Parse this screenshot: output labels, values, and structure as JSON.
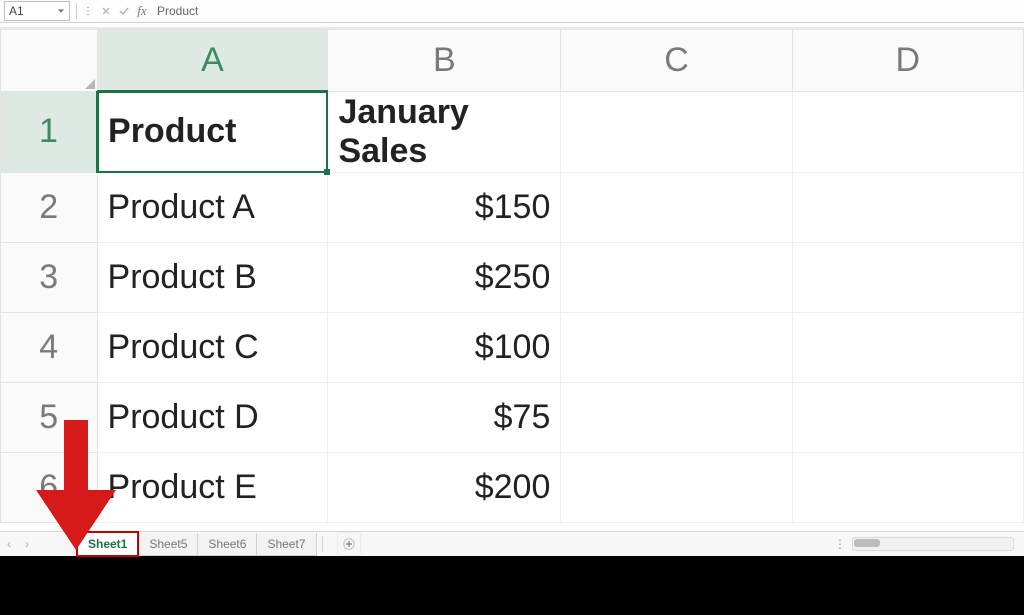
{
  "namebox": "A1",
  "formula_value": "Product",
  "columns": [
    "A",
    "B",
    "C",
    "D"
  ],
  "rows": [
    {
      "n": "1",
      "A": "Product",
      "B": "January Sales",
      "boldA": true,
      "boldB": true,
      "selected": true
    },
    {
      "n": "2",
      "A": "Product A",
      "B": "$150"
    },
    {
      "n": "3",
      "A": "Product B",
      "B": "$250"
    },
    {
      "n": "4",
      "A": "Product C",
      "B": "$100"
    },
    {
      "n": "5",
      "A": "Product D",
      "B": "$75"
    },
    {
      "n": "6",
      "A": "Product E",
      "B": "$200"
    }
  ],
  "sheet_tabs": [
    {
      "label": "Sheet1",
      "active": true
    },
    {
      "label": "Sheet5",
      "active": false
    },
    {
      "label": "Sheet6",
      "active": false
    },
    {
      "label": "Sheet7",
      "active": false
    }
  ],
  "icons": {
    "cancel": "✕",
    "enter": "✓",
    "fx": "fx",
    "newtab": "+",
    "nav_left_small": "‹",
    "nav_right_small": "›",
    "dropdown": "▾",
    "dots": "⋮"
  },
  "annotation": {
    "arrow_note": "Red arrow pointing to the Sheet1 tab"
  }
}
